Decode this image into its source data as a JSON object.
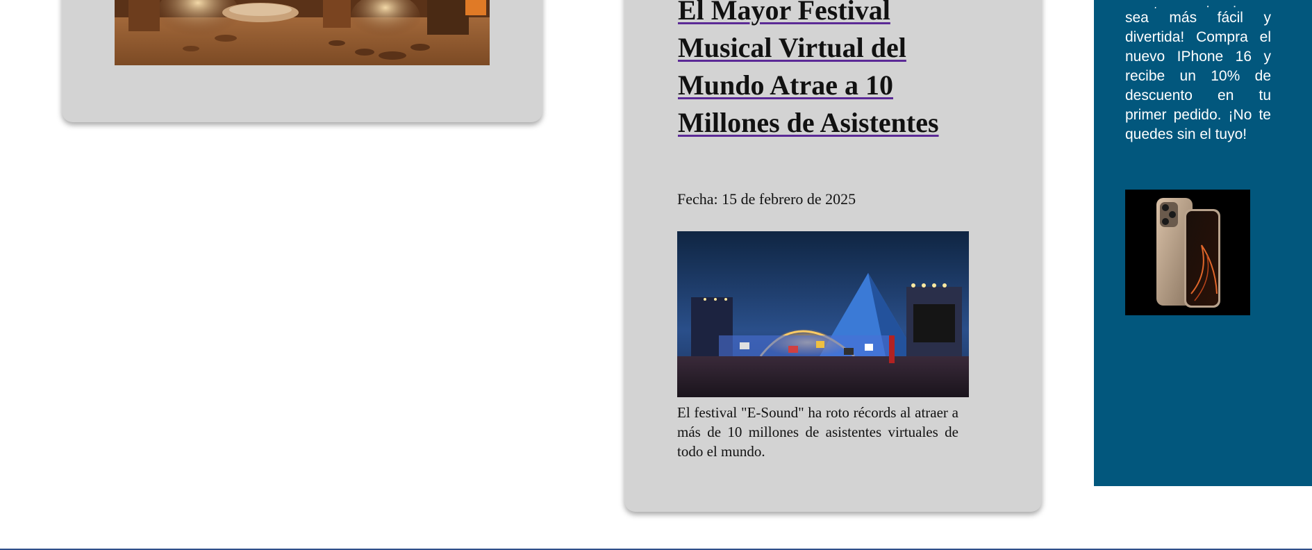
{
  "articles": [
    {
      "title": "",
      "date": "",
      "summary": ""
    },
    {
      "title": "El Mayor Festival Musical Virtual del Mundo Atrae a 10 Millones de Asistentes",
      "date": "Fecha: 15 de febrero de 2025",
      "summary": "El festival \"E-Sound\" ha roto récords al atraer a más de 10 millones de asistentes virtuales de todo el mundo."
    }
  ],
  "ad": {
    "text_partial_top": "que tu experiencia",
    "text": "sea más fácil y divertida! Compra el nuevo IPhone 16 y recibe un 10% de descuento en tu primer pedido. ¡No te quedes sin el tuyo!",
    "image_alt": "iPhone 16"
  },
  "colors": {
    "card_bg": "#d3d3d3",
    "ad_bg": "#02577d",
    "link_underline": "#5b2a96"
  }
}
